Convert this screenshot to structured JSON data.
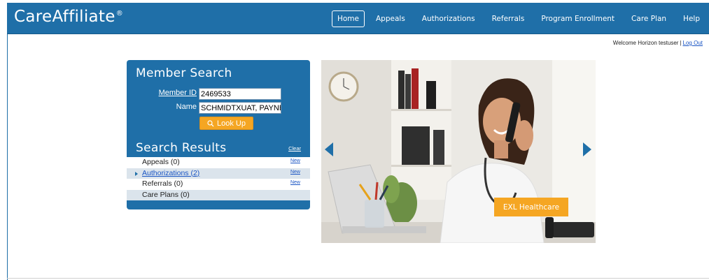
{
  "app": {
    "brand": "CareAffiliate",
    "brand_mark": "®",
    "accent_color": "#1f6fa8",
    "highlight_color": "#f5a623"
  },
  "nav": {
    "items": [
      {
        "label": "Home",
        "active": true
      },
      {
        "label": "Appeals"
      },
      {
        "label": "Authorizations"
      },
      {
        "label": "Referrals"
      },
      {
        "label": "Program Enrollment"
      },
      {
        "label": "Care Plan"
      },
      {
        "label": "Help"
      }
    ]
  },
  "user": {
    "welcome_text": "Welcome Horizon testuser",
    "separator": "|",
    "logout_label": "Log Out"
  },
  "member_search": {
    "title": "Member Search",
    "member_id_label": "Member ID",
    "member_id_value": "2469533",
    "name_label": "Name",
    "name_value": "SCHMIDTXUAT, PAYNE",
    "lookup_label": "Look Up",
    "lookup_icon": "search-icon"
  },
  "search_results": {
    "title": "Search Results",
    "clear_label": "Clear",
    "rows": [
      {
        "label": "Appeals (0)",
        "new_label": "New"
      },
      {
        "label": "Authorizations (2)",
        "new_label": "New",
        "expandable": true
      },
      {
        "label": "Referrals (0)",
        "new_label": "New"
      },
      {
        "label": "Care Plans (0)"
      }
    ]
  },
  "hero": {
    "caption": "EXL Healthcare",
    "prev_icon": "chevron-left-icon",
    "next_icon": "chevron-right-icon"
  }
}
